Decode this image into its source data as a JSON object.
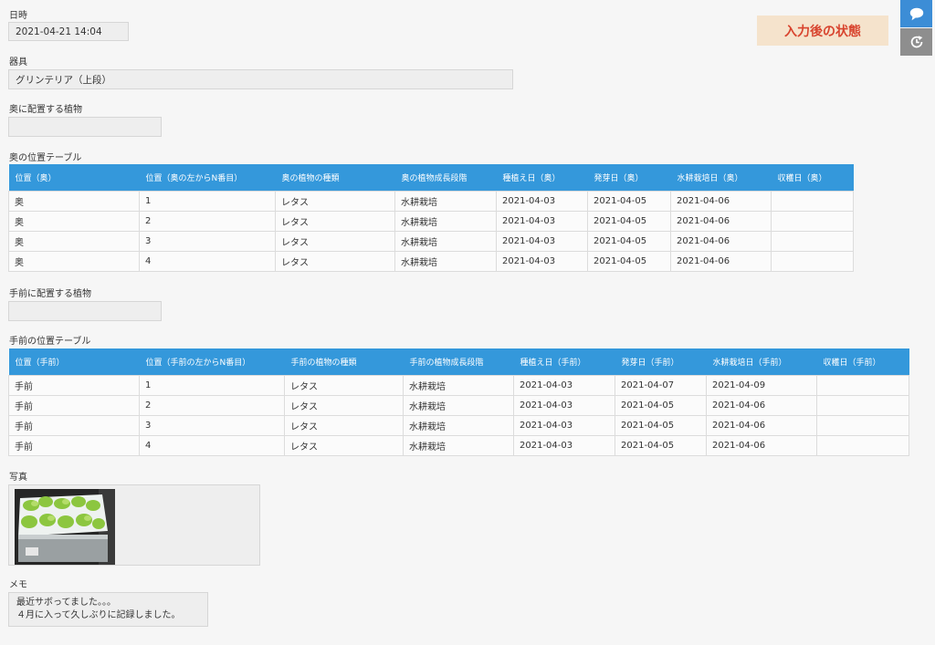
{
  "datetime": {
    "label": "日時",
    "value": "2021-04-21 14:04"
  },
  "device": {
    "label": "器具",
    "value": "グリンテリア（上段）"
  },
  "back_plants": {
    "label": "奥に配置する植物",
    "value": ""
  },
  "back_table": {
    "title": "奥の位置テーブル",
    "headers": [
      "位置（奥）",
      "位置（奥の左からN番目）",
      "奥の植物の種類",
      "奥の植物成長段階",
      "種植え日（奥）",
      "発芽日（奥）",
      "水耕栽培日（奥）",
      "収穫日（奥）"
    ],
    "rows": [
      [
        "奥",
        "1",
        "レタス",
        "水耕栽培",
        "2021-04-03",
        "2021-04-05",
        "2021-04-06",
        ""
      ],
      [
        "奥",
        "2",
        "レタス",
        "水耕栽培",
        "2021-04-03",
        "2021-04-05",
        "2021-04-06",
        ""
      ],
      [
        "奥",
        "3",
        "レタス",
        "水耕栽培",
        "2021-04-03",
        "2021-04-05",
        "2021-04-06",
        ""
      ],
      [
        "奥",
        "4",
        "レタス",
        "水耕栽培",
        "2021-04-03",
        "2021-04-05",
        "2021-04-06",
        ""
      ]
    ]
  },
  "front_plants": {
    "label": "手前に配置する植物",
    "value": ""
  },
  "front_table": {
    "title": "手前の位置テーブル",
    "headers": [
      "位置（手前）",
      "位置（手前の左からN番目）",
      "手前の植物の種類",
      "手前の植物成長段階",
      "種植え日（手前）",
      "発芽日（手前）",
      "水耕栽培日（手前）",
      "収穫日（手前）"
    ],
    "rows": [
      [
        "手前",
        "1",
        "レタス",
        "水耕栽培",
        "2021-04-03",
        "2021-04-07",
        "2021-04-09",
        ""
      ],
      [
        "手前",
        "2",
        "レタス",
        "水耕栽培",
        "2021-04-03",
        "2021-04-05",
        "2021-04-06",
        ""
      ],
      [
        "手前",
        "3",
        "レタス",
        "水耕栽培",
        "2021-04-03",
        "2021-04-05",
        "2021-04-06",
        ""
      ],
      [
        "手前",
        "4",
        "レタス",
        "水耕栽培",
        "2021-04-03",
        "2021-04-05",
        "2021-04-06",
        ""
      ]
    ]
  },
  "photo": {
    "label": "写真"
  },
  "memo": {
    "label": "メモ",
    "lines": [
      "最近サボってました。。。",
      "４月に入って久しぶりに記録しました。"
    ]
  },
  "status_badge": "入力後の状態",
  "side_buttons": {
    "chat_icon": "chat-bubble-icon",
    "history_icon": "history-clock-icon"
  },
  "colors": {
    "accent": "#3498db",
    "badge_bg": "#f5e3cc",
    "badge_text": "#d8442e"
  }
}
